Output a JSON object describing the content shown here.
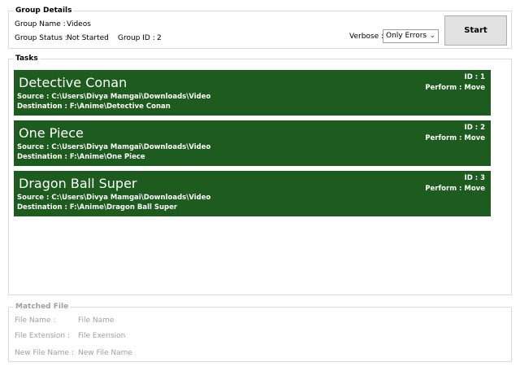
{
  "group": {
    "legend": "Group Details",
    "name_label": "Group Name :",
    "name_value": "Videos",
    "status_label": "Group Status :",
    "status_value": "Not Started",
    "id_label": "Group ID :",
    "id_value": "2",
    "verbose_label": "Verbose :",
    "verbose_value": "Only Errors",
    "start_label": "Start"
  },
  "tasks": {
    "legend": "Tasks",
    "items": [
      {
        "title": "Detective Conan",
        "source": "Source : C:\\Users\\Divya Mamgai\\Downloads\\Video",
        "destination": "Destination : F:\\Anime\\Detective Conan",
        "id": "ID : 1",
        "perform": "Perform : Move"
      },
      {
        "title": "One Piece",
        "source": "Source : C:\\Users\\Divya Mamgai\\Downloads\\Video",
        "destination": "Destination : F:\\Anime\\One Piece",
        "id": "ID : 2",
        "perform": "Perform : Move"
      },
      {
        "title": "Dragon Ball Super",
        "source": "Source : C:\\Users\\Divya Mamgai\\Downloads\\Video",
        "destination": "Destination : F:\\Anime\\Dragon Ball Super",
        "id": "ID : 3",
        "perform": "Perform : Move"
      }
    ]
  },
  "matched": {
    "legend": "Matched File",
    "file_name_label": "File Name :",
    "file_name_value": "File Name",
    "file_ext_label": "File Extension :",
    "file_ext_value": "File Exension",
    "new_file_name_label": "New File Name :",
    "new_file_name_value": "New File Name"
  },
  "colors": {
    "task_background": "#1e5b1e",
    "disabled_text": "#a0a0a0"
  }
}
